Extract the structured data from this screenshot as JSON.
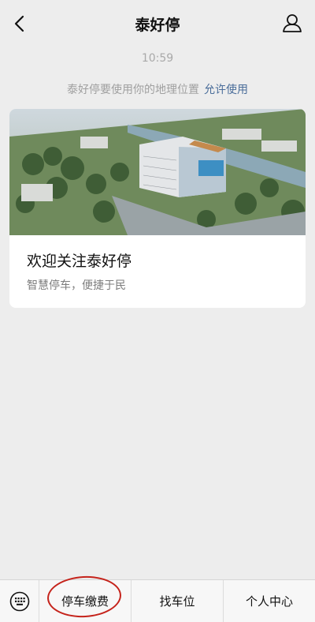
{
  "nav": {
    "title": "泰好停",
    "back_icon": "chevron-left-icon",
    "profile_icon": "person-icon"
  },
  "chat": {
    "time": "10:59",
    "notice": {
      "text": "泰好停要使用你的地理位置",
      "action": "允许使用"
    }
  },
  "card": {
    "image": "aerial-building-rendering",
    "title": "欢迎关注泰好停",
    "subtitle": "智慧停车，便捷于民"
  },
  "menu": {
    "keyboard_icon": "keyboard-icon",
    "items": [
      {
        "label": "停车缴费",
        "highlighted": true
      },
      {
        "label": "找车位"
      },
      {
        "label": "个人中心"
      }
    ],
    "highlight_color": "#c5231b"
  }
}
